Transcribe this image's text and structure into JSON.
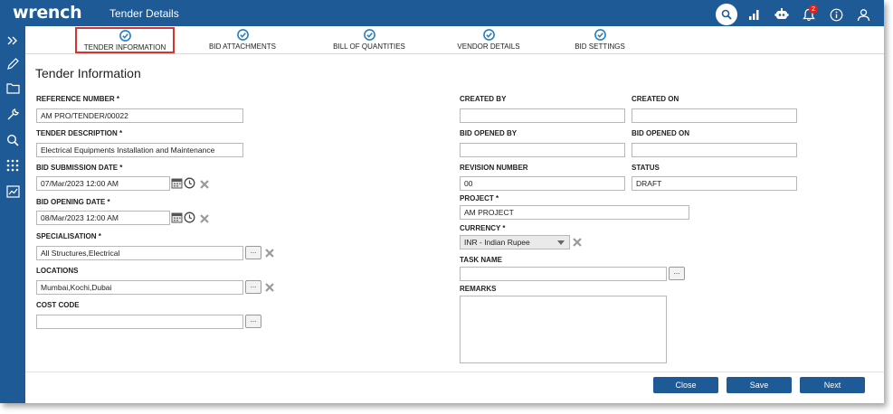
{
  "header": {
    "logo": "wrench",
    "title": "Tender Details",
    "notification_count": "2"
  },
  "sidebar": {
    "items": [
      "expand-icon",
      "edit-icon",
      "folder-icon",
      "wrench-icon",
      "search-icon",
      "apps-grid-icon",
      "dashboard-icon"
    ]
  },
  "steps": [
    {
      "label": "TENDER INFORMATION",
      "active": true
    },
    {
      "label": "BID ATTACHMENTS"
    },
    {
      "label": "BILL OF QUANTITIES"
    },
    {
      "label": "VENDOR DETAILS"
    },
    {
      "label": "BID SETTINGS"
    }
  ],
  "section_title": "Tender Information",
  "left": {
    "reference_number": {
      "label": "REFERENCE NUMBER *",
      "value": "AM PRO/TENDER/00022"
    },
    "tender_description": {
      "label": "TENDER DESCRIPTION *",
      "value": "Electrical Equipments Installation and Maintenance"
    },
    "bid_submission_date": {
      "label": "BID SUBMISSION DATE *",
      "value": "07/Mar/2023 12:00 AM"
    },
    "bid_opening_date": {
      "label": "BID OPENING DATE *",
      "value": "08/Mar/2023 12:00 AM"
    },
    "specialisation": {
      "label": "SPECIALISATION *",
      "value": "All Structures,Electrical"
    },
    "locations": {
      "label": "LOCATIONS",
      "value": "Mumbai,Kochi,Dubai"
    },
    "cost_code": {
      "label": "COST CODE",
      "value": ""
    }
  },
  "right": {
    "created_by": {
      "label": "CREATED BY",
      "value": ""
    },
    "created_on": {
      "label": "CREATED ON",
      "value": ""
    },
    "bid_opened_by": {
      "label": "BID OPENED BY",
      "value": ""
    },
    "bid_opened_on": {
      "label": "BID OPENED ON",
      "value": ""
    },
    "revision_number": {
      "label": "REVISION NUMBER",
      "value": "00"
    },
    "status": {
      "label": "STATUS",
      "value": "DRAFT"
    },
    "project": {
      "label": "PROJECT *",
      "value": "AM PROJECT"
    },
    "currency": {
      "label": "CURRENCY *",
      "value": "INR - Indian Rupee"
    },
    "task_name": {
      "label": "TASK NAME",
      "value": ""
    },
    "remarks": {
      "label": "REMARKS",
      "value": ""
    }
  },
  "lookup_label": "...",
  "buttons": {
    "close": "Close",
    "save": "Save",
    "next": "Next"
  },
  "colors": {
    "brand": "#1d5a96",
    "highlight": "#d9342b",
    "check": "#2a7fc1"
  }
}
